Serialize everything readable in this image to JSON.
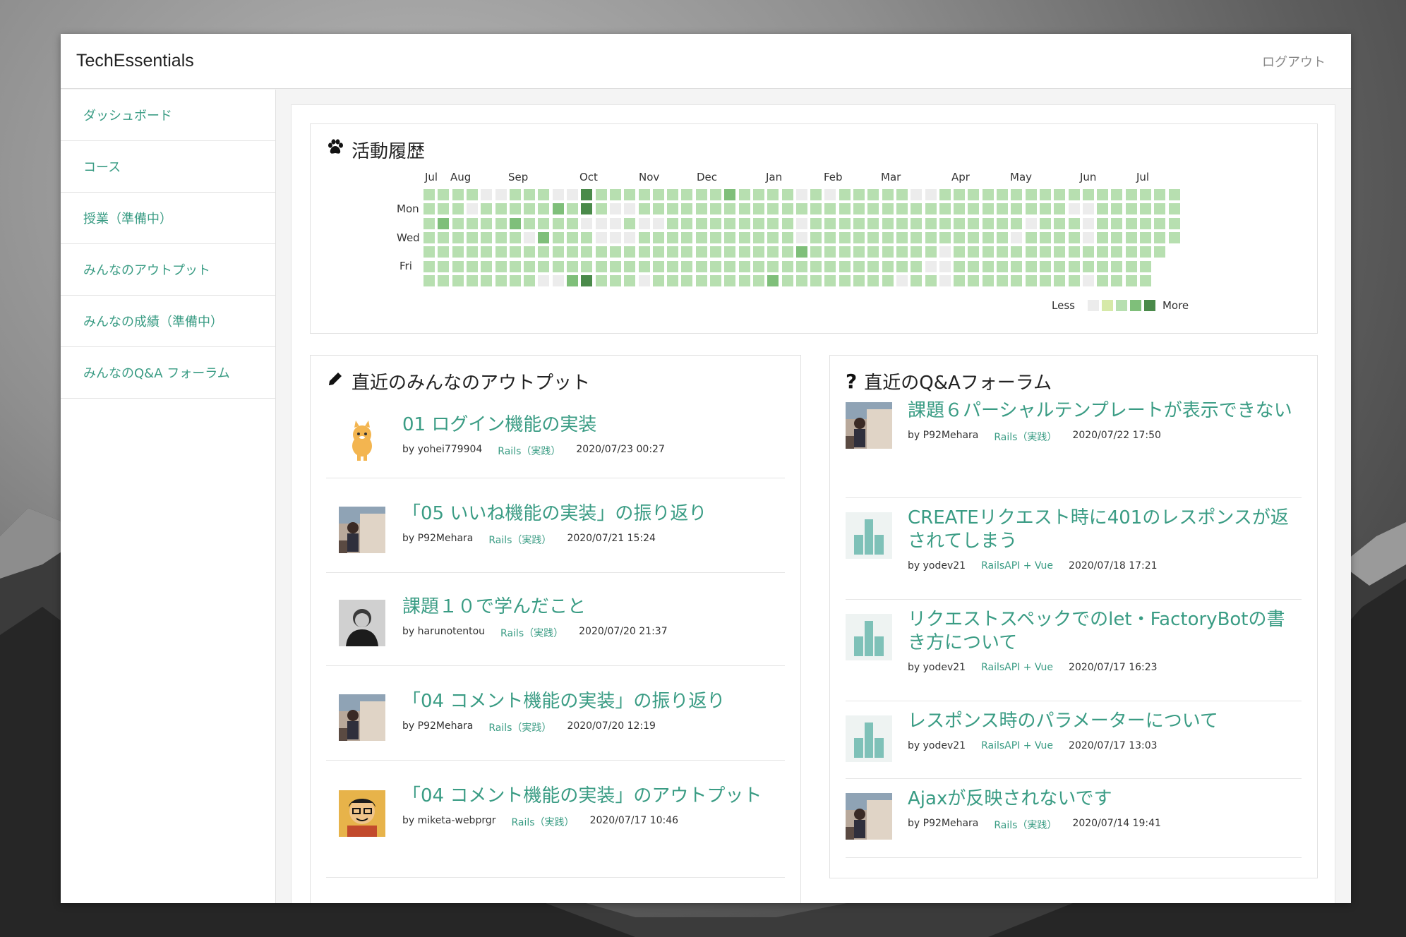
{
  "brand": "TechEssentials",
  "logout_label": "ログアウト",
  "sidebar": {
    "items": [
      {
        "label": "ダッシュボード"
      },
      {
        "label": "コース"
      },
      {
        "label": "授業（準備中）"
      },
      {
        "label": "みんなのアウトプット"
      },
      {
        "label": "みんなの成績（準備中）"
      },
      {
        "label": "みんなのQ&A フォーラム"
      }
    ]
  },
  "activity": {
    "title": "活動履歴",
    "icon": "paw-icon",
    "months": [
      "Jul",
      "Aug",
      "Sep",
      "Oct",
      "Nov",
      "Dec",
      "Jan",
      "Feb",
      "Mar",
      "Apr",
      "May",
      "Jun",
      "Jul"
    ],
    "days": [
      "Mon",
      "Wed",
      "Fri"
    ],
    "legend_less": "Less",
    "legend_more": "More",
    "colors": [
      "#ececec",
      "#d6e9a8",
      "#b7dfb0",
      "#7fbf7a",
      "#4a8a4a"
    ]
  },
  "outputs": {
    "title": "直近のみんなのアウトプット",
    "icon": "pencil-icon",
    "items": [
      {
        "title": "01 ログイン機能の実装",
        "author": "by yohei779904",
        "category": "Rails（実践）",
        "date": "2020/07/23 00:27",
        "avatar": "cat-avatar"
      },
      {
        "title": "「05 いいね機能の実装」の振り返り",
        "author": "by P92Mehara",
        "category": "Rails（実践）",
        "date": "2020/07/21 15:24",
        "avatar": "photo-avatar"
      },
      {
        "title": "課題１０で学んだこと",
        "author": "by harunotentou",
        "category": "Rails（実践）",
        "date": "2020/07/20 21:37",
        "avatar": "bw-photo-avatar"
      },
      {
        "title": "「04 コメント機能の実装」の振り返り",
        "author": "by P92Mehara",
        "category": "Rails（実践）",
        "date": "2020/07/20 12:19",
        "avatar": "photo-avatar"
      },
      {
        "title": "「04 コメント機能の実装」のアウトプット",
        "author": "by miketa-webprgr",
        "category": "Rails（実践）",
        "date": "2020/07/17 10:46",
        "avatar": "illustration-avatar"
      }
    ]
  },
  "qa": {
    "title": "直近のQ&Aフォーラム",
    "icon": "question-icon",
    "items": [
      {
        "title": "課題６パーシャルテンプレートが表示できない",
        "author": "by P92Mehara",
        "category": "Rails（実践）",
        "date": "2020/07/22 17:50",
        "avatar": "photo-avatar"
      },
      {
        "title": "CREATEリクエスト時に401のレスポンスが返されてしまう",
        "author": "by yodev21",
        "category": "RailsAPI + Vue",
        "date": "2020/07/18 17:21",
        "avatar": "default-avatar"
      },
      {
        "title": "リクエストスペックでのlet・FactoryBotの書き方について",
        "author": "by yodev21",
        "category": "RailsAPI + Vue",
        "date": "2020/07/17 16:23",
        "avatar": "default-avatar"
      },
      {
        "title": "レスポンス時のパラメーターについて",
        "author": "by yodev21",
        "category": "RailsAPI + Vue",
        "date": "2020/07/17 13:03",
        "avatar": "default-avatar"
      },
      {
        "title": "Ajaxが反映されないです",
        "author": "by P92Mehara",
        "category": "Rails（実践）",
        "date": "2020/07/14 19:41",
        "avatar": "photo-avatar"
      }
    ]
  }
}
